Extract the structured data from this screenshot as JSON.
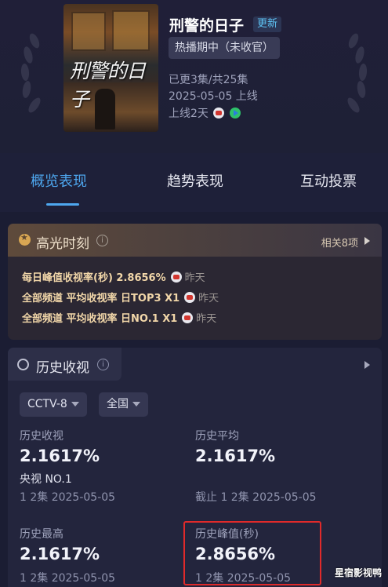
{
  "show": {
    "title": "刑警的日子",
    "update_badge": "更新",
    "status": "热播期中（未收官）",
    "episodes": "已更3集/共25集",
    "premiere": "2025-05-05 上线",
    "online_days": "上线2天",
    "poster_title": "刑警的日子"
  },
  "tabs": [
    "概览表现",
    "趋势表现",
    "互动投票"
  ],
  "highlights": {
    "title": "高光时刻",
    "related": "相关8项",
    "rows": [
      {
        "text": "每日峰值收视率(秒)  2.8656%",
        "when": "昨天"
      },
      {
        "text": "全部频道 平均收视率 日TOP3 X1",
        "when": "昨天"
      },
      {
        "text": "全部频道 平均收视率 日NO.1 X1",
        "when": "昨天"
      }
    ]
  },
  "history": {
    "title": "历史收视",
    "channel": "CCTV-8",
    "region": "全国",
    "stats": {
      "total": {
        "label": "历史收视",
        "value": "2.1617%",
        "sub": "央视 NO.1"
      },
      "avg": {
        "label": "历史平均",
        "value": "2.1617%",
        "sub": "截止 1 2集 2025-05-05"
      },
      "max": {
        "label": "历史最高",
        "value": "2.1617%",
        "sub": "1 2集 2025-05-05"
      },
      "peak": {
        "label": "历史峰值(秒)",
        "value": "2.8656%",
        "sub": "1 2集 2025-05-05"
      },
      "total_extra": "1 2集 2025-05-05"
    }
  },
  "watermark": "星宿影视鸭",
  "colors": {
    "accent": "#4ea7ef",
    "highlight_text": "#f2d7a9",
    "box_red": "#e02a2a"
  }
}
